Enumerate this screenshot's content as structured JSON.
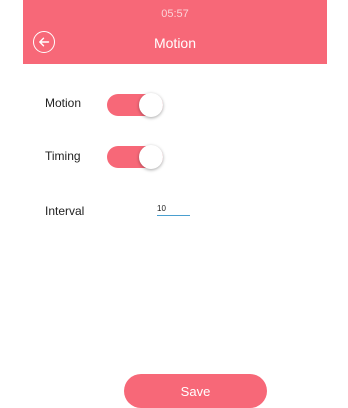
{
  "status_bar": {
    "time": "05:57"
  },
  "header": {
    "title": "Motion",
    "back_icon": "back-arrow-circle-icon"
  },
  "settings": {
    "motion": {
      "label": "Motion",
      "enabled": true
    },
    "timing": {
      "label": "Timing",
      "enabled": true
    },
    "interval": {
      "label": "Interval",
      "value": "10"
    }
  },
  "actions": {
    "save_label": "Save"
  },
  "colors": {
    "accent": "#f76878",
    "input_underline": "#4a9fcf"
  }
}
